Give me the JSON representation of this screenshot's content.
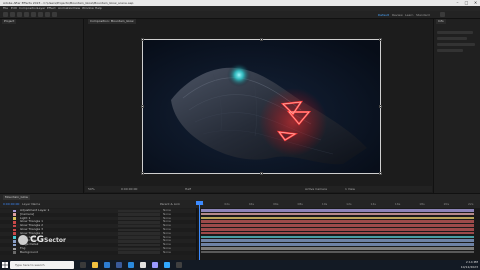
{
  "window": {
    "title": "Adobe After Effects 2023 - C:\\Users\\Projects\\Mountain_Glow\\Mountain_Glow_scene.aep",
    "controls": [
      "–",
      "□",
      "✕"
    ]
  },
  "menu": [
    "File",
    "Edit",
    "Composition",
    "Layer",
    "Effect",
    "Animation",
    "View",
    "Window",
    "Help"
  ],
  "toolbar": {
    "workspaces": [
      "Default",
      "Review",
      "Learn",
      "Standard",
      "Small Screen",
      "Libraries"
    ],
    "active_workspace": "Default"
  },
  "project_panel": {
    "tab": "Project"
  },
  "composition_panel": {
    "tab": "Composition: Mountain_Glow",
    "view_controls": {
      "zoom": "50%",
      "resolution": "Half",
      "timecode": "0:00:00:00",
      "camera": "Active Camera",
      "view": "1 View"
    }
  },
  "right_panel": {
    "tab": "Info"
  },
  "timeline": {
    "tab": "Mountain_Glow",
    "timecode": "0:00:00:00",
    "headers": {
      "layer_name": "Layer Name",
      "parent": "Parent & Link"
    },
    "ruler_ticks": [
      "0s",
      "02s",
      "04s",
      "06s",
      "08s",
      "10s",
      "12s",
      "14s",
      "16s",
      "18s",
      "20s",
      "22s"
    ],
    "layers": [
      {
        "name": "Adjustment Layer 1",
        "label_color": "#a99ad6",
        "parent": "None"
      },
      {
        "name": "[Camera]",
        "label_color": "#e0a0a0",
        "parent": "None"
      },
      {
        "name": "Light 1",
        "label_color": "#d8c25a",
        "parent": "None"
      },
      {
        "name": "Glow Triangle 1",
        "label_color": "#c84848",
        "parent": "None"
      },
      {
        "name": "Glow Triangle 2",
        "label_color": "#c84848",
        "parent": "None"
      },
      {
        "name": "Glow Triangle 3",
        "label_color": "#c84848",
        "parent": "None"
      },
      {
        "name": "Glow Triangle 4",
        "label_color": "#c84848",
        "parent": "None"
      },
      {
        "name": "Cyan Glow",
        "label_color": "#4ac8d0",
        "parent": "None"
      },
      {
        "name": "Terrain Mesh",
        "label_color": "#8aa0c8",
        "parent": "None"
      },
      {
        "name": "Ridge Detail",
        "label_color": "#8aa0c8",
        "parent": "None"
      },
      {
        "name": "Fog",
        "label_color": "#a0a0a0",
        "parent": "None"
      },
      {
        "name": "Background",
        "label_color": "#6a6a6a",
        "parent": "None"
      }
    ],
    "bar_colors": [
      "#8c84b8",
      "#b48a8a",
      "#b8a55a",
      "#9c4a4a",
      "#9c4a4a",
      "#9c4a4a",
      "#9c4a4a",
      "#4a9ca2",
      "#6e82a6",
      "#6e82a6",
      "#7c7c7c",
      "#5a5a5a"
    ]
  },
  "watermark": {
    "brand_prefix": "CG",
    "brand_name": "Sector"
  },
  "taskbar": {
    "search_placeholder": "Type here to search",
    "time": "2:14 PM",
    "date": "10/12/2023"
  }
}
